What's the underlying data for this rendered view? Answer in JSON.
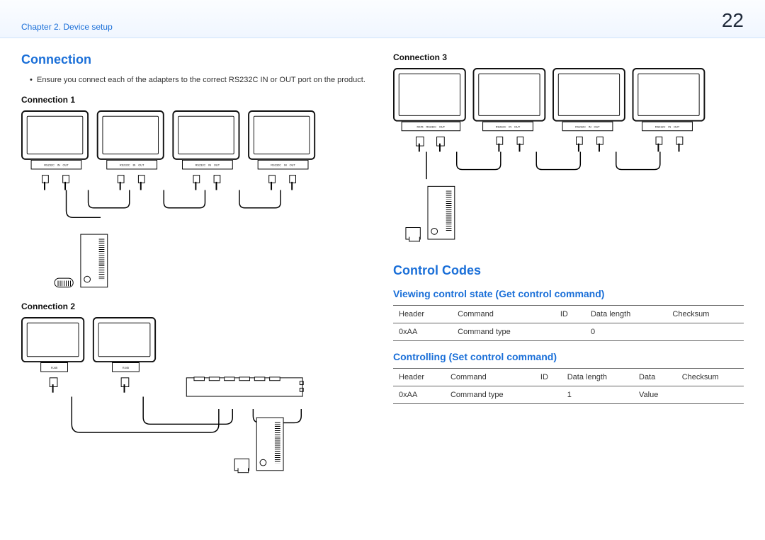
{
  "header": {
    "chapter": "Chapter 2. Device setup",
    "page": "22"
  },
  "left": {
    "section": "Connection",
    "bullet": "Ensure you connect each of the adapters to the correct RS232C IN or OUT port on the product.",
    "conn1_title": "Connection 1",
    "conn2_title": "Connection 2",
    "portlabels": {
      "rs232c": "RS232C",
      "in": "IN",
      "out": "OUT",
      "rj45": "RJ45"
    }
  },
  "right": {
    "conn3_title": "Connection 3",
    "portlabels": {
      "rj45": "RJ45",
      "rs232c": "RS232C",
      "in": "IN",
      "out": "OUT"
    },
    "codes_section": "Control Codes",
    "get_title": "Viewing control state (Get control command)",
    "set_title": "Controlling (Set control command)",
    "get_table": {
      "h": [
        "Header",
        "Command",
        "ID",
        "Data length",
        "Checksum"
      ],
      "r": [
        "0xAA",
        "Command type",
        "",
        "0",
        ""
      ]
    },
    "set_table": {
      "h": [
        "Header",
        "Command",
        "ID",
        "Data length",
        "Data",
        "Checksum"
      ],
      "r": [
        "0xAA",
        "Command type",
        "",
        "1",
        "Value",
        ""
      ]
    }
  }
}
